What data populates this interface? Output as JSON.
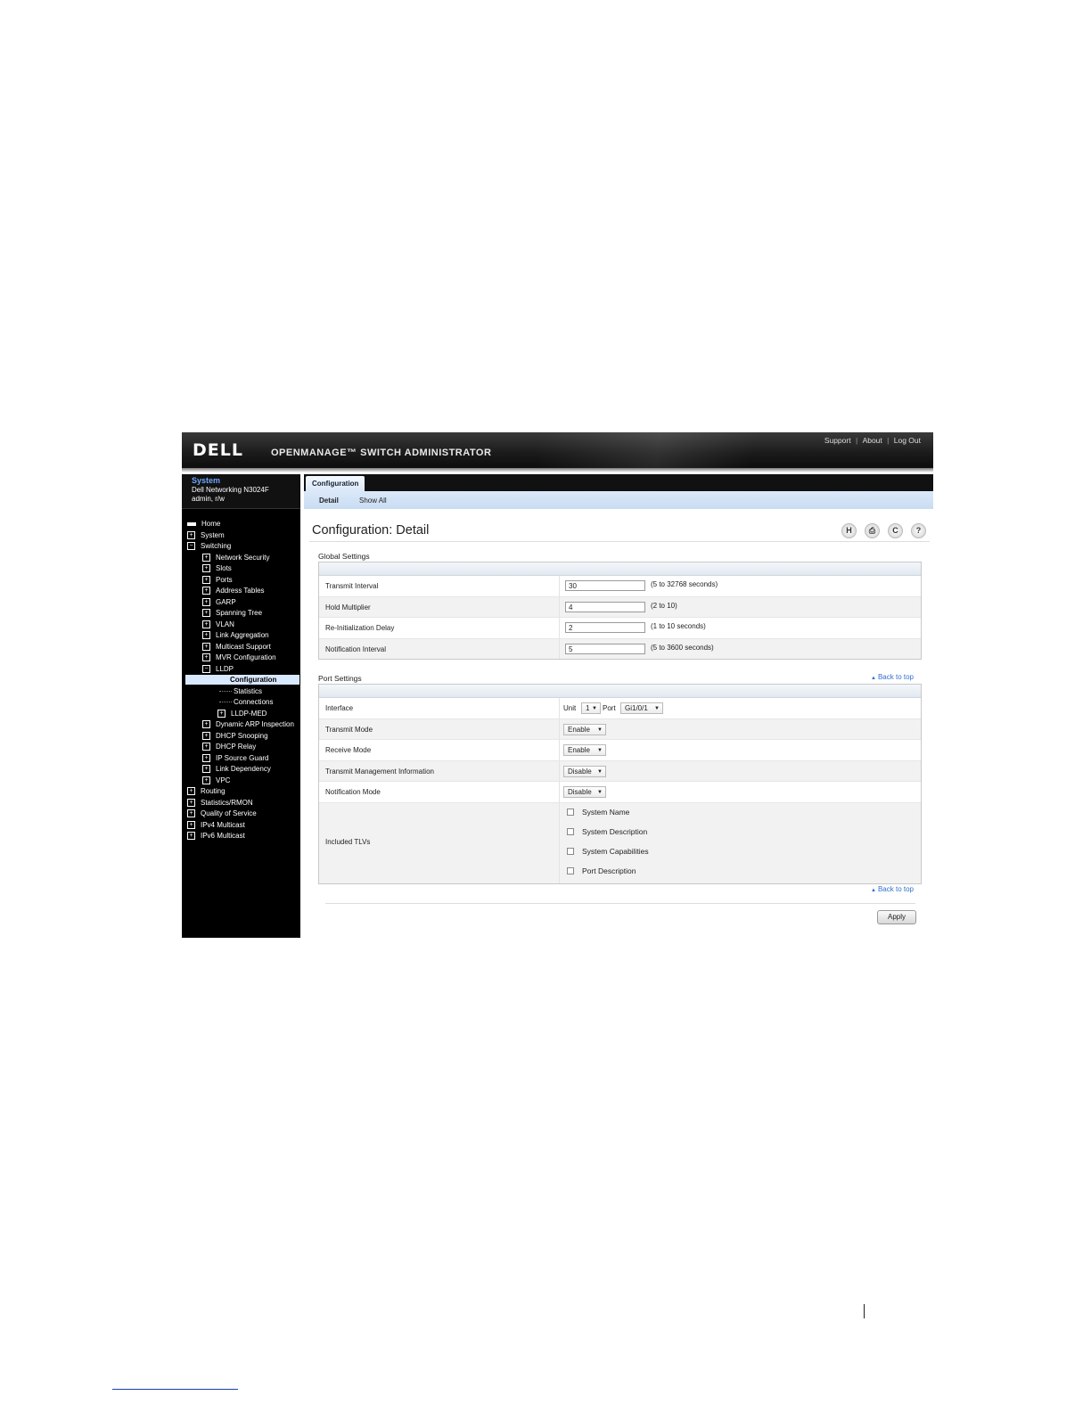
{
  "header": {
    "logo": "DELL",
    "product": "OPENMANAGE™ SWITCH ADMINISTRATOR",
    "links": [
      "Support",
      "About",
      "Log Out"
    ],
    "link_separator": "|"
  },
  "system": {
    "title": "System",
    "model": "Dell Networking N3024F",
    "user": "admin, r/w"
  },
  "nav": {
    "home": "Home",
    "system": "System",
    "switching": "Switching",
    "switching_items": [
      "Network Security",
      "Slots",
      "Ports",
      "Address Tables",
      "GARP",
      "Spanning Tree",
      "VLAN",
      "Link Aggregation",
      "Multicast Support",
      "MVR Configuration"
    ],
    "lldp": "LLDP",
    "lldp_items": [
      "Configuration",
      "Statistics",
      "Connections"
    ],
    "lldp_med": "LLDP-MED",
    "switching_items_after": [
      "Dynamic ARP Inspection",
      "DHCP Snooping",
      "DHCP Relay",
      "IP Source Guard",
      "Link Dependency",
      "VPC"
    ],
    "top_after": [
      "Routing",
      "Statistics/RMON",
      "Quality of Service",
      "IPv4 Multicast",
      "IPv6 Multicast"
    ],
    "expand_glyph": "+",
    "collapse_glyph": "−"
  },
  "tabs": {
    "main": "Configuration",
    "sub": [
      "Detail",
      "Show All"
    ]
  },
  "page": {
    "title": "Configuration: Detail",
    "toolbar_icons": [
      "save-icon",
      "print-icon",
      "refresh-icon",
      "help-icon"
    ],
    "toolbar_glyphs": [
      "H",
      "⎙",
      "C",
      "?"
    ]
  },
  "global": {
    "label": "Global Settings",
    "rows": [
      {
        "label": "Transmit Interval",
        "value": "30",
        "range": "(5 to 32768 seconds)"
      },
      {
        "label": "Hold Multiplier",
        "value": "4",
        "range": "(2 to 10)"
      },
      {
        "label": "Re-Initialization Delay",
        "value": "2",
        "range": "(1 to 10 seconds)"
      },
      {
        "label": "Notification Interval",
        "value": "5",
        "range": "(5 to 3600 seconds)"
      }
    ]
  },
  "port": {
    "label": "Port Settings",
    "back_to_top": "Back to top",
    "back_arrow": "▲",
    "caret": "▼",
    "interface": {
      "label": "Interface",
      "unit_label": "Unit",
      "unit_value": "1",
      "port_label": "Port",
      "port_value": "Gi1/0/1"
    },
    "modes": [
      {
        "label": "Transmit Mode",
        "value": "Enable"
      },
      {
        "label": "Receive Mode",
        "value": "Enable"
      },
      {
        "label": "Transmit Management Information",
        "value": "Disable"
      },
      {
        "label": "Notification Mode",
        "value": "Disable"
      }
    ],
    "tlv_label": "Included TLVs",
    "tlvs": [
      "System Name",
      "System Description",
      "System Capabilities",
      "Port Description"
    ]
  },
  "apply_label": "Apply"
}
